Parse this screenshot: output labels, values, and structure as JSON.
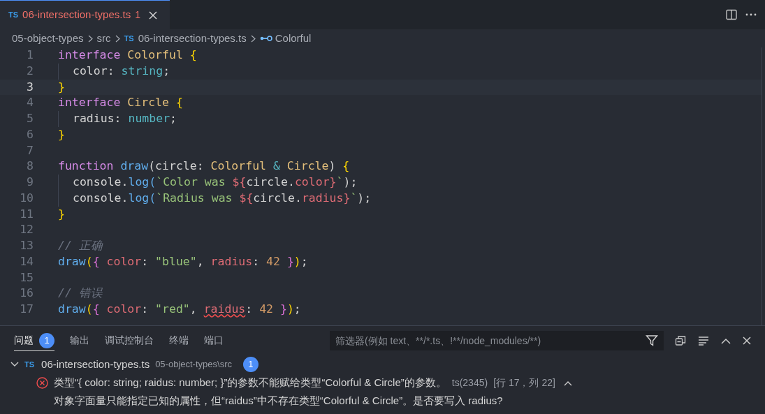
{
  "tab": {
    "icon": "TS",
    "label": "06-intersection-types.ts",
    "problems": "1",
    "selected": true
  },
  "breadcrumb": [
    {
      "kind": "folder",
      "label": "05-object-types"
    },
    {
      "kind": "folder",
      "label": "src"
    },
    {
      "kind": "file",
      "icon": "TS",
      "label": "06-intersection-types.ts"
    },
    {
      "kind": "symbol",
      "label": "Colorful"
    }
  ],
  "editor": {
    "lines": [
      {
        "number": "1",
        "current": false,
        "tokens": [
          {
            "text": "interface ",
            "kind": "kw"
          },
          {
            "text": "Colorful ",
            "kind": "type"
          },
          {
            "text": "{",
            "kind": "br1"
          }
        ]
      },
      {
        "number": "2",
        "current": false,
        "indented": true,
        "tokens": [
          {
            "text": "color",
            "kind": "plain"
          },
          {
            "text": ": ",
            "kind": "plain"
          },
          {
            "text": "string",
            "kind": "prim"
          },
          {
            "text": ";",
            "kind": "plain"
          }
        ]
      },
      {
        "number": "3",
        "current": true,
        "tokens": [
          {
            "text": "}",
            "kind": "br1"
          }
        ]
      },
      {
        "number": "4",
        "current": false,
        "tokens": [
          {
            "text": "interface ",
            "kind": "kw"
          },
          {
            "text": "Circle ",
            "kind": "type"
          },
          {
            "text": "{",
            "kind": "br1"
          }
        ]
      },
      {
        "number": "5",
        "current": false,
        "indented": true,
        "tokens": [
          {
            "text": "radius",
            "kind": "plain"
          },
          {
            "text": ": ",
            "kind": "plain"
          },
          {
            "text": "number",
            "kind": "prim"
          },
          {
            "text": ";",
            "kind": "plain"
          }
        ]
      },
      {
        "number": "6",
        "current": false,
        "tokens": [
          {
            "text": "}",
            "kind": "br1"
          }
        ]
      },
      {
        "number": "7",
        "current": false
      },
      {
        "number": "8",
        "current": false,
        "tokens": [
          {
            "text": "function ",
            "kind": "kw"
          },
          {
            "text": "draw",
            "kind": "fn"
          },
          {
            "text": "(circle: ",
            "kind": "plain"
          },
          {
            "text": "Colorful ",
            "kind": "type"
          },
          {
            "text": "& ",
            "kind": "prim"
          },
          {
            "text": "Circle",
            "kind": "type"
          },
          {
            "text": ") ",
            "kind": "plain"
          },
          {
            "text": "{",
            "kind": "br1"
          }
        ]
      },
      {
        "number": "9",
        "current": false,
        "indented": true,
        "tokens": [
          {
            "text": "console.",
            "kind": "plain"
          },
          {
            "text": "log(",
            "kind": "fn"
          },
          {
            "text": "`Color was ",
            "kind": "str"
          },
          {
            "text": "${",
            "kind": "interp"
          },
          {
            "text": "circle.",
            "kind": "plain"
          },
          {
            "text": "color}",
            "kind": "interp"
          },
          {
            "text": "`",
            "kind": "str"
          },
          {
            "text": ");",
            "kind": "plain"
          }
        ]
      },
      {
        "number": "10",
        "current": false,
        "indented": true,
        "tokens": [
          {
            "text": "console.",
            "kind": "plain"
          },
          {
            "text": "log(",
            "kind": "fn"
          },
          {
            "text": "`Radius was ",
            "kind": "str"
          },
          {
            "text": "${",
            "kind": "interp"
          },
          {
            "text": "circle.",
            "kind": "plain"
          },
          {
            "text": "radius}",
            "kind": "interp"
          },
          {
            "text": "`",
            "kind": "str"
          },
          {
            "text": ");",
            "kind": "plain"
          }
        ]
      },
      {
        "number": "11",
        "current": false,
        "tokens": [
          {
            "text": "}",
            "kind": "br1"
          }
        ]
      },
      {
        "number": "12",
        "current": false
      },
      {
        "number": "13",
        "current": false,
        "tokens": [
          {
            "text": "// 正确",
            "kind": "comment"
          }
        ]
      },
      {
        "number": "14",
        "current": false,
        "tokens": [
          {
            "text": "draw",
            "kind": "fn"
          },
          {
            "text": "(",
            "kind": "br1"
          },
          {
            "text": "{ ",
            "kind": "br2"
          },
          {
            "text": "color",
            "kind": "prop"
          },
          {
            "text": ": ",
            "kind": "plain"
          },
          {
            "text": "\"blue\"",
            "kind": "str"
          },
          {
            "text": ", ",
            "kind": "plain"
          },
          {
            "text": "radius",
            "kind": "prop"
          },
          {
            "text": ": ",
            "kind": "plain"
          },
          {
            "text": "42 ",
            "kind": "num"
          },
          {
            "text": "}",
            "kind": "br2"
          },
          {
            "text": ")",
            "kind": "br1"
          },
          {
            "text": ";",
            "kind": "plain"
          }
        ]
      },
      {
        "number": "15",
        "current": false
      },
      {
        "number": "16",
        "current": false,
        "tokens": [
          {
            "text": "// 错误",
            "kind": "comment"
          }
        ]
      },
      {
        "number": "17",
        "current": false,
        "tokens": [
          {
            "text": "draw",
            "kind": "fn"
          },
          {
            "text": "(",
            "kind": "br1"
          },
          {
            "text": "{ ",
            "kind": "br2"
          },
          {
            "text": "color",
            "kind": "prop"
          },
          {
            "text": ": ",
            "kind": "plain"
          },
          {
            "text": "\"red\"",
            "kind": "str"
          },
          {
            "text": ", ",
            "kind": "plain"
          },
          {
            "text": "raidus",
            "kind": "error"
          },
          {
            "text": ": ",
            "kind": "plain"
          },
          {
            "text": "42 ",
            "kind": "num"
          },
          {
            "text": "}",
            "kind": "br2"
          },
          {
            "text": ")",
            "kind": "br1"
          },
          {
            "text": ";",
            "kind": "plain"
          }
        ]
      }
    ]
  },
  "panel": {
    "tabs": [
      {
        "label": "问题",
        "badge": "1",
        "selected": true
      },
      {
        "label": "输出",
        "selected": false
      },
      {
        "label": "调试控制台",
        "selected": false
      },
      {
        "label": "终端",
        "selected": false
      },
      {
        "label": "端口",
        "selected": false
      }
    ],
    "filter": {
      "placeholder": "筛选器(例如 text、**/*.ts、!**/node_modules/**)"
    },
    "file": {
      "expanded": true,
      "icon": "TS",
      "name": "06-intersection-types.ts",
      "path": "05-object-types\\src",
      "count": "1"
    },
    "problem": {
      "message": "类型“{ color: string; raidus: number; }”的参数不能赋给类型“Colorful & Circle”的参数。",
      "code": "ts(2345)",
      "location": "[行 17，列 22]",
      "detail": "对象字面量只能指定已知的属性，但“raidus”中不存在类型“Colorful & Circle”。是否要写入 radius?"
    }
  }
}
